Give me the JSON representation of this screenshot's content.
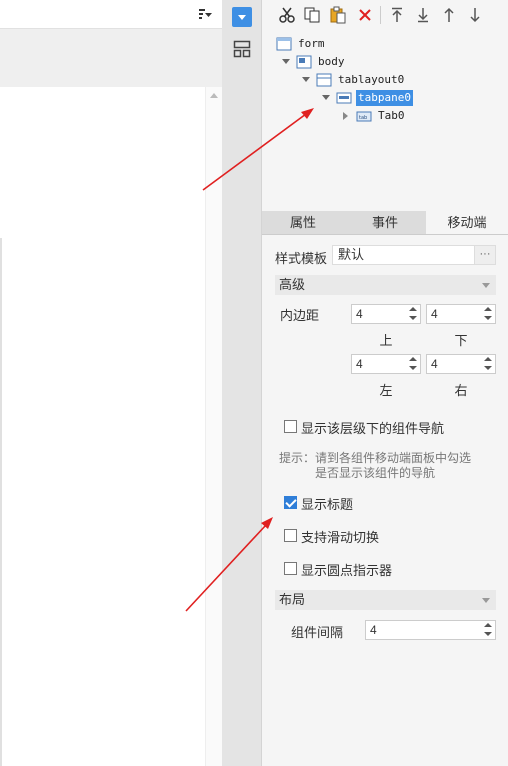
{
  "toolbar": {
    "buttons": [
      {
        "name": "cut-icon"
      },
      {
        "name": "copy-icon"
      },
      {
        "name": "paste-icon"
      },
      {
        "name": "delete-icon"
      },
      {
        "name": "move-top-icon"
      },
      {
        "name": "move-bottom-icon"
      },
      {
        "name": "move-up-icon"
      },
      {
        "name": "move-down-icon"
      }
    ]
  },
  "tree": {
    "nodes": [
      {
        "label": "form",
        "icon": "form-icon"
      },
      {
        "label": "body",
        "icon": "body-icon"
      },
      {
        "label": "tablayout0",
        "icon": "tablayout-icon"
      },
      {
        "label": "tabpane0",
        "icon": "tabpane-icon",
        "selected": true
      },
      {
        "label": "Tab0",
        "icon": "tab-icon"
      }
    ]
  },
  "tabs": [
    {
      "label": "属性"
    },
    {
      "label": "事件"
    },
    {
      "label": "移动端",
      "active": true
    }
  ],
  "style_template": {
    "label": "样式模板",
    "value": "默认",
    "button": "···"
  },
  "advanced": {
    "title": "高级",
    "padding_label": "内边距",
    "top": {
      "value": "4",
      "label": "上"
    },
    "bottom": {
      "value": "4",
      "label": "下"
    },
    "left": {
      "value": "4",
      "label": "左"
    },
    "right": {
      "value": "4",
      "label": "右"
    }
  },
  "options": {
    "show_nav": {
      "label": "显示该层级下的组件导航",
      "checked": false
    },
    "hint_line1": "提示：请到各组件移动端面板中勾选",
    "hint_line2": "是否显示该组件的导航",
    "show_title": {
      "label": "显示标题",
      "checked": true
    },
    "swipe": {
      "label": "支持滑动切换",
      "checked": false
    },
    "dots": {
      "label": "显示圆点指示器",
      "checked": false
    }
  },
  "layout": {
    "title": "布局",
    "spacing_label": "组件间隔",
    "spacing_value": "4"
  },
  "colors": {
    "accent": "#3e8fe4",
    "arrow": "#e02020"
  }
}
